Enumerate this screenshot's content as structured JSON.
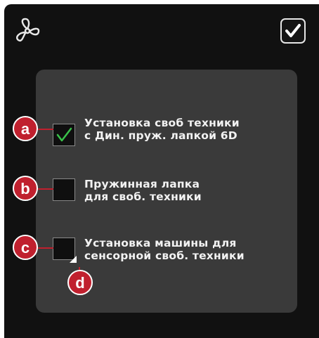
{
  "header": {
    "menu_icon": "fan-icon",
    "confirm_icon": "checkmark-icon"
  },
  "options": [
    {
      "line1": "Установка своб техники",
      "line2": "с Дин. пруж. лапкой 6D",
      "checked": true
    },
    {
      "line1": "Пружинная лапка",
      "line2": "для своб. техники",
      "checked": false
    },
    {
      "line1": "Установка машины для",
      "line2": "сенсорной своб. техники",
      "checked": false
    }
  ],
  "callouts": {
    "a": "a",
    "b": "b",
    "c": "c",
    "d": "d"
  },
  "colors": {
    "background": "#111111",
    "panel": "#3a3a3a",
    "check_green": "#39c24a",
    "callout_red": "#c0202e"
  }
}
